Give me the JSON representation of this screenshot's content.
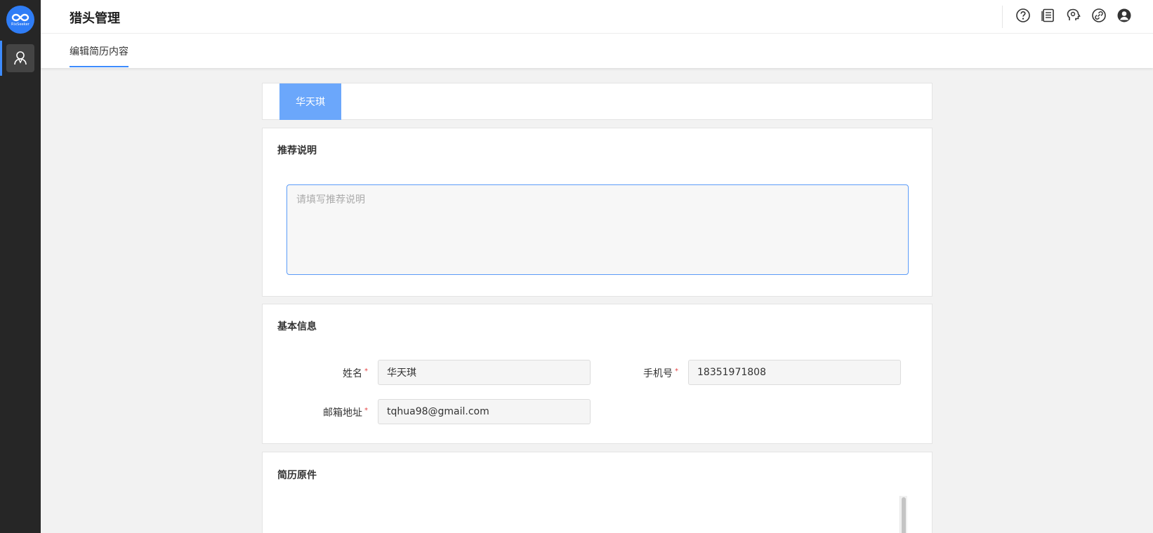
{
  "sidebar": {
    "logo_text": "RixSeeker",
    "items": [
      {
        "icon": "user-icon",
        "active": true
      }
    ]
  },
  "header": {
    "title": "猎头管理",
    "icons": [
      "help-icon",
      "document-icon",
      "brain-icon",
      "link-icon",
      "account-icon"
    ]
  },
  "tabs": [
    {
      "label": "编辑简历内容",
      "active": true
    }
  ],
  "candidate_tab": {
    "label": "华天琪"
  },
  "recommendation": {
    "title": "推荐说明",
    "placeholder": "请填写推荐说明",
    "value": ""
  },
  "basic_info": {
    "title": "基本信息",
    "required_mark": "*",
    "fields": {
      "name": {
        "label": "姓名",
        "value": "华天琪"
      },
      "phone": {
        "label": "手机号",
        "value": "18351971808"
      },
      "email": {
        "label": "邮箱地址",
        "value": "tqhua98@gmail.com"
      }
    }
  },
  "resume_original": {
    "title": "简历原件"
  },
  "colors": {
    "accent": "#3d8bfd",
    "sidebar_bg": "#262626",
    "tab_active_bg": "#6ba7fb",
    "required": "#e64545"
  }
}
